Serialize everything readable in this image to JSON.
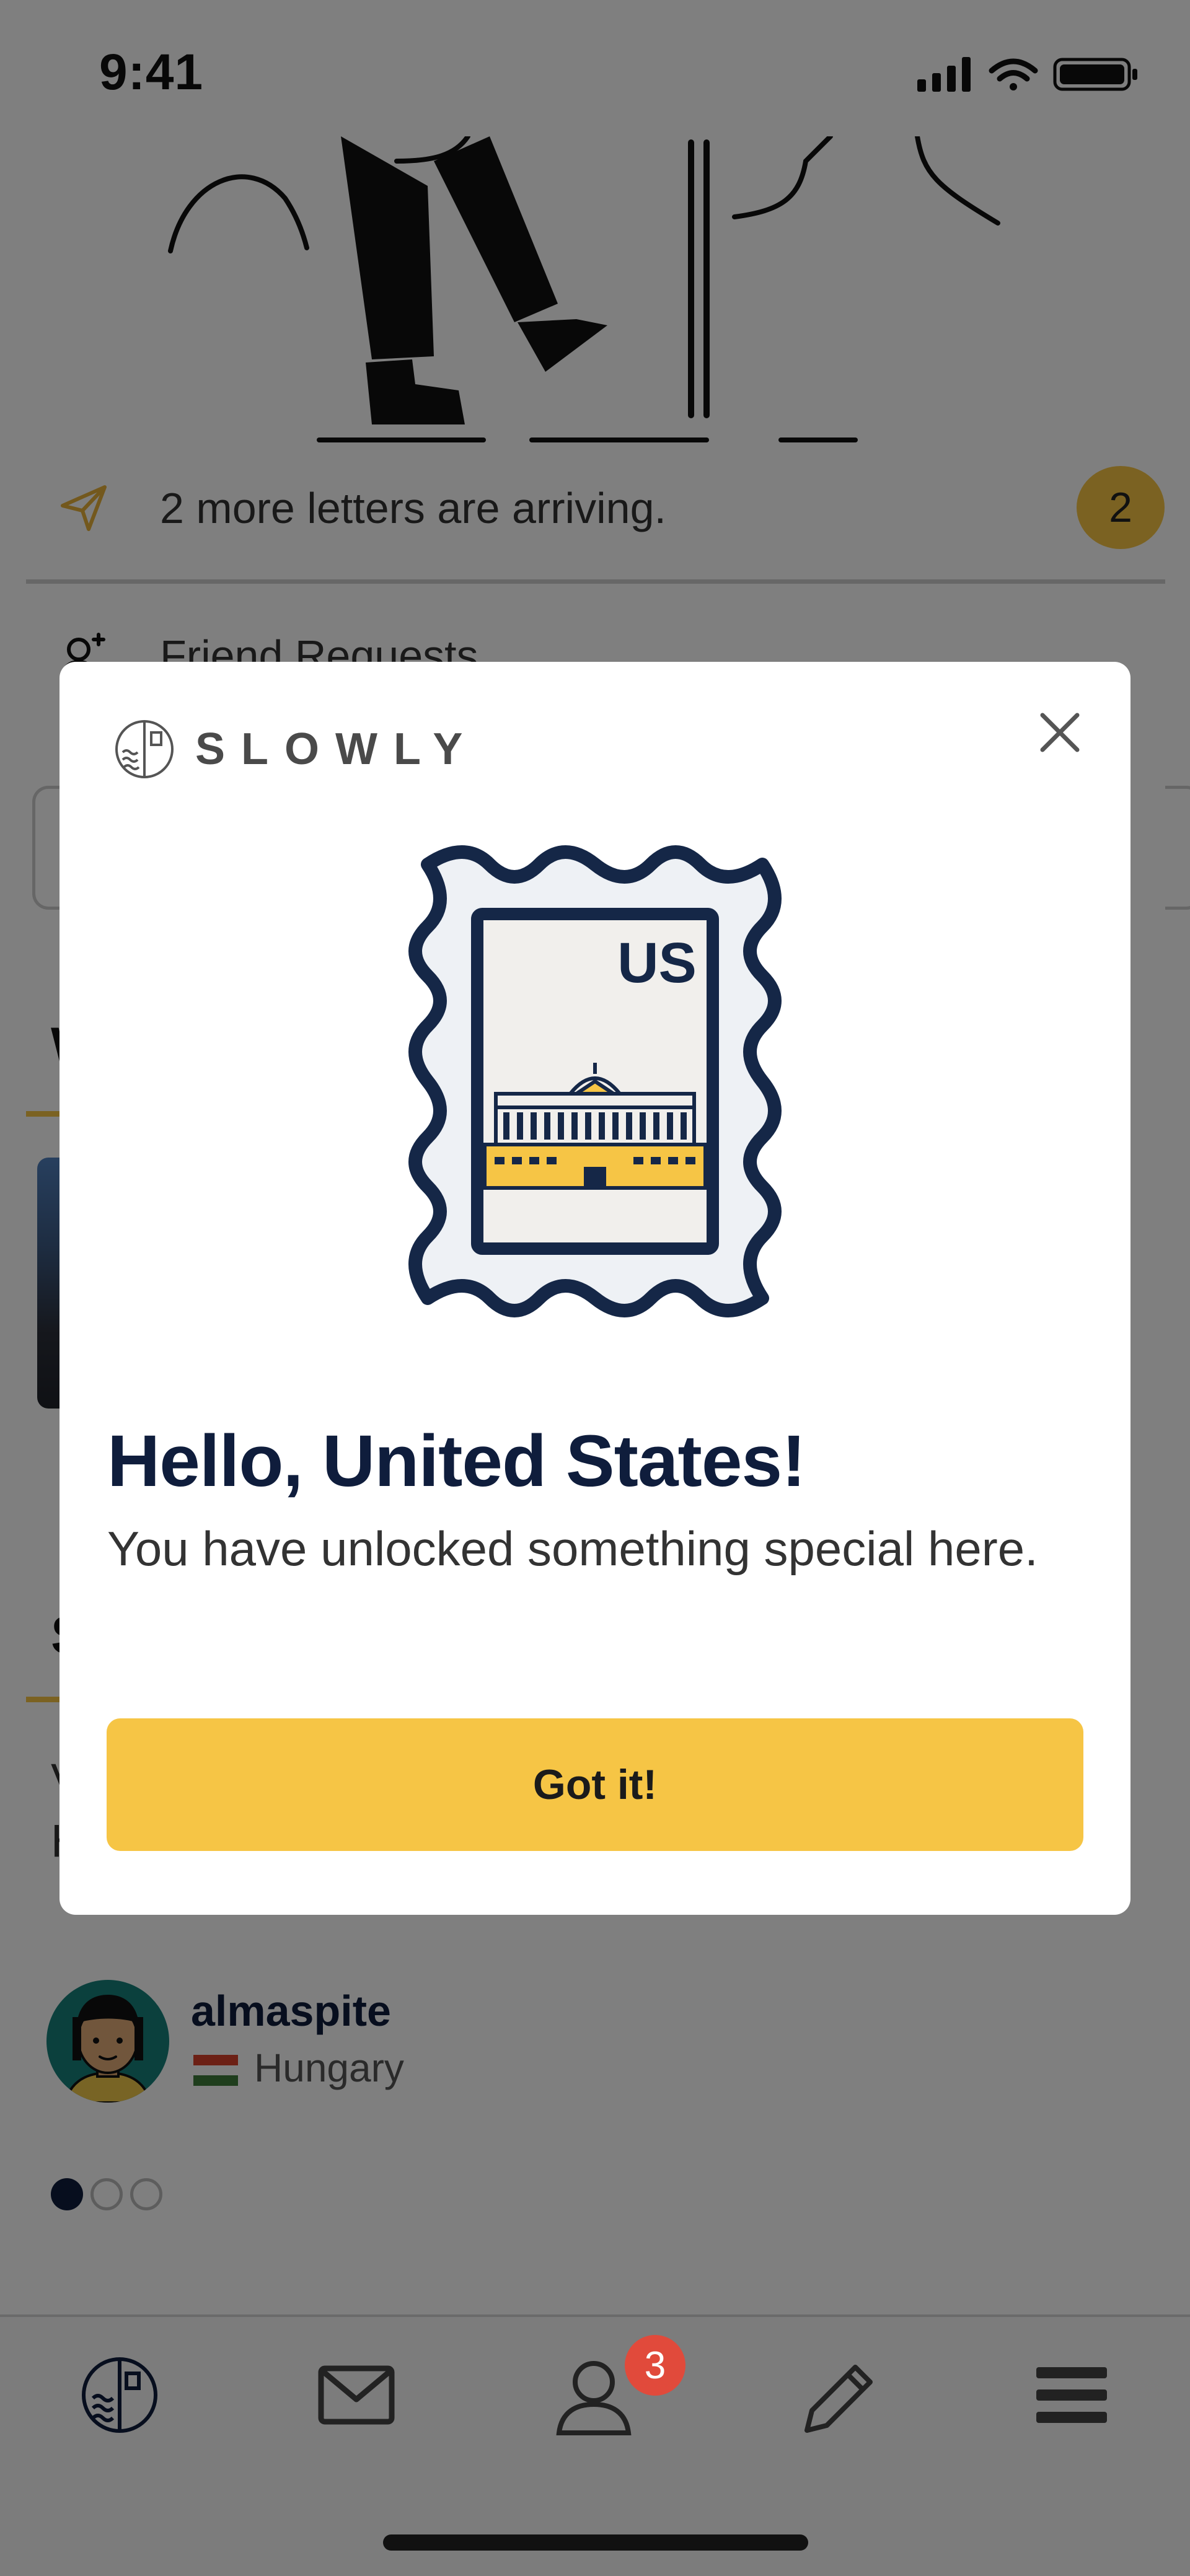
{
  "status_bar": {
    "time": "9:41"
  },
  "home": {
    "arriving_text": "2 more letters are arriving.",
    "arriving_count": "2",
    "friend_requests_label": "Friend Requests",
    "section_1_initial": "W",
    "section_2_initial": "S",
    "section_2_body_line1_initial": "V",
    "section_2_body_line2_initial": "H",
    "suggested_user": {
      "name": "almaspite",
      "country": "Hungary"
    },
    "pager": {
      "total": 3,
      "active": 1
    }
  },
  "tab_bar": {
    "items": [
      "home-icon",
      "letters-icon",
      "friends-icon",
      "compose-icon",
      "menu-icon"
    ],
    "friends_badge": "3"
  },
  "modal": {
    "brand": "SLOWLY",
    "stamp_country_code": "US",
    "title": "Hello, United States!",
    "subtitle": "You have unlocked something special here.",
    "button_label": "Got it!"
  },
  "colors": {
    "accent_yellow": "#f6c545",
    "navy": "#0f1d3c",
    "badge_red": "#e14a3b",
    "overlay": "rgba(0,0,0,0.5)"
  }
}
